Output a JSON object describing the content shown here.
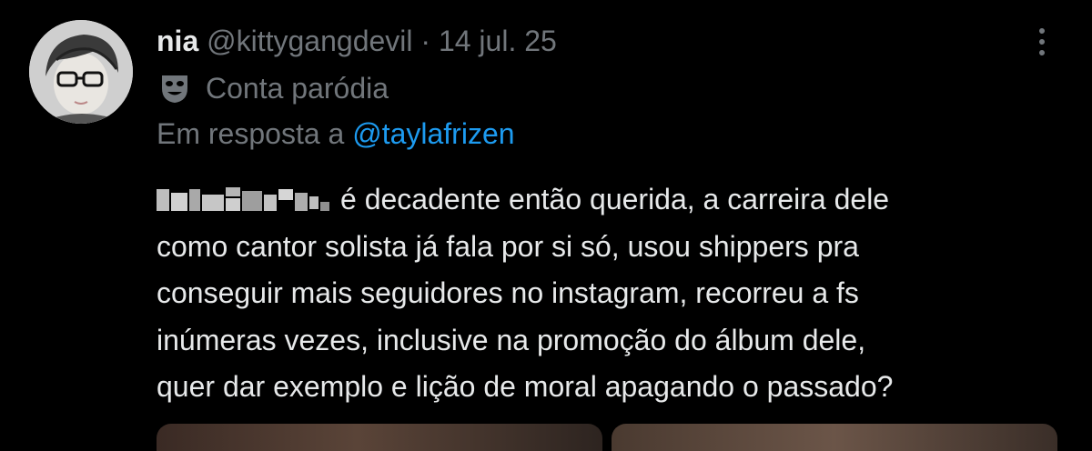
{
  "tweet": {
    "author": {
      "name": "nia",
      "handle": "@kittygangdevil",
      "avatar_icon": "avatar-image"
    },
    "separator": "·",
    "date": "14 jul. 25",
    "account_label": "Conta paródia",
    "account_label_icon": "parody-mask-icon",
    "reply_prefix": "Em resposta a",
    "reply_to": "@taylafrizen",
    "text_lines": [
      "é decadente então querida, a carreira dele",
      "como cantor solista já fala por si só, usou shippers pra",
      "conseguir mais seguidores no instagram, recorreu a fs",
      "inúmeras vezes, inclusive na promoção do álbum dele,",
      "quer dar exemplo e lição de moral apagando o passado?"
    ],
    "more_icon": "more-options-icon"
  },
  "colors": {
    "background": "#000000",
    "primary_text": "#e7e9ea",
    "secondary_text": "#71767b",
    "accent": "#1d9bf0"
  }
}
